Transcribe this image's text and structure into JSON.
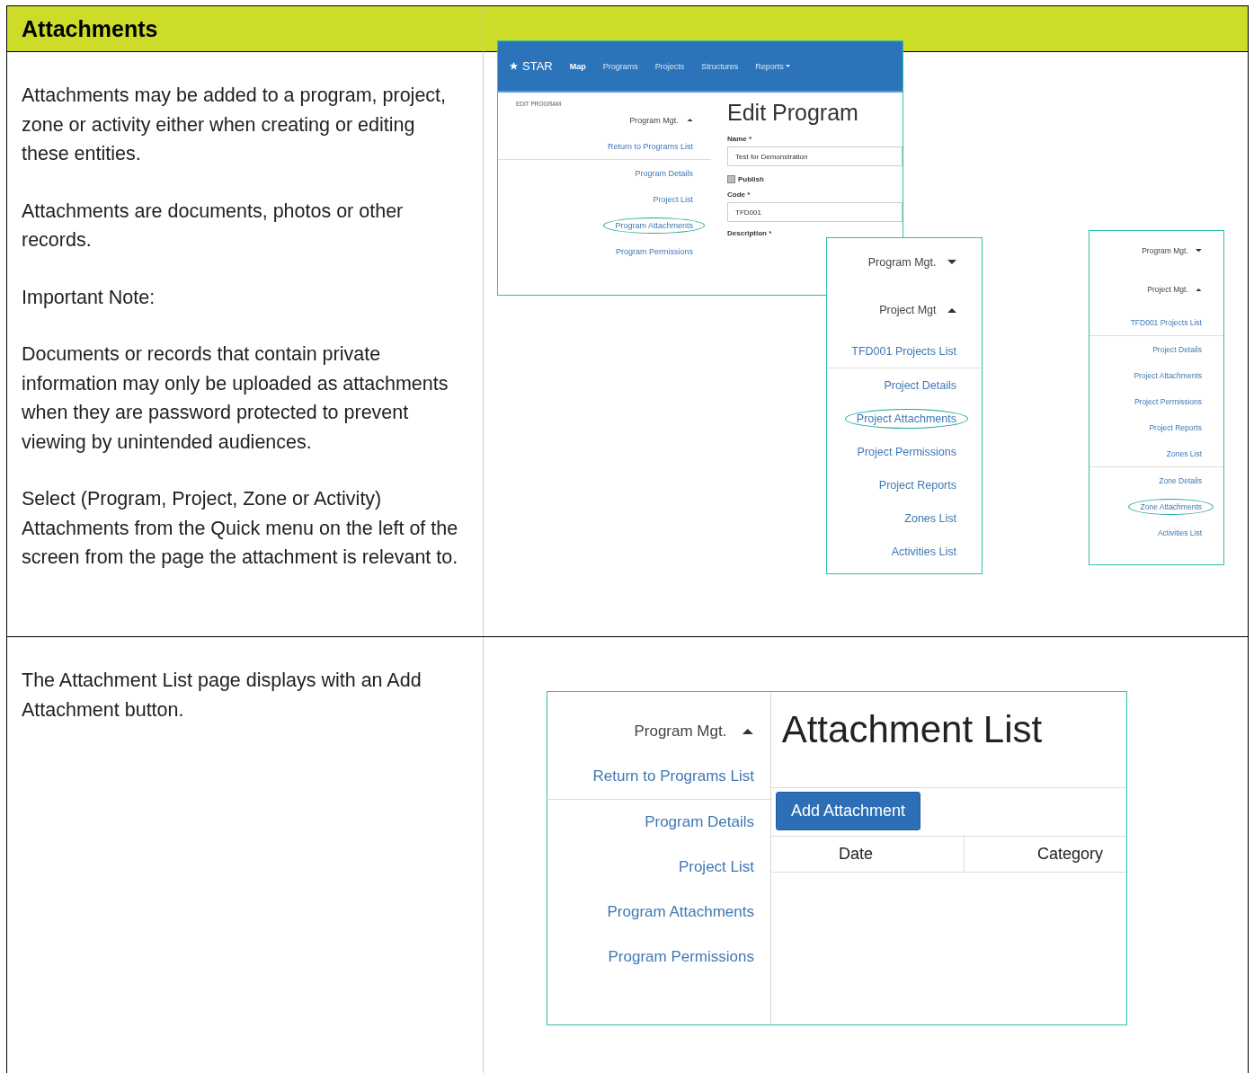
{
  "header": {
    "title": "Attachments"
  },
  "intro": {
    "paragraphs": [
      "Attachments may be added to a program, project, zone or activity either when creating or editing these entities.",
      "Attachments are documents, photos or other records.",
      "Important Note:",
      "Documents or records that contain private information may only be uploaded as attachments when they are password protected to prevent viewing by unintended audiences.",
      "Select (Program, Project, Zone or Activity) Attachments from the Quick menu on the left of the screen from the page the attachment is relevant to."
    ]
  },
  "edit_program_screenshot": {
    "navbar": {
      "brand": "STAR",
      "items": [
        {
          "label": "Map",
          "selected": true,
          "dropdown": false
        },
        {
          "label": "Programs",
          "selected": false,
          "dropdown": false
        },
        {
          "label": "Projects",
          "selected": false,
          "dropdown": false
        },
        {
          "label": "Structures",
          "selected": false,
          "dropdown": false
        },
        {
          "label": "Reports",
          "selected": false,
          "dropdown": true
        }
      ]
    },
    "breadcrumb": "EDIT PROGRAM",
    "sidebar": [
      {
        "kind": "group",
        "label": "Program Mgt.",
        "expanded": true
      },
      {
        "kind": "link",
        "label": "Return to Programs List",
        "circled": false
      },
      {
        "kind": "divider"
      },
      {
        "kind": "link",
        "label": "Program Details",
        "circled": false
      },
      {
        "kind": "link",
        "label": "Project List",
        "circled": false
      },
      {
        "kind": "link",
        "label": "Program Attachments",
        "circled": true
      },
      {
        "kind": "link",
        "label": "Program Permissions",
        "circled": false
      }
    ],
    "form": {
      "title": "Edit Program",
      "fields": [
        {
          "kind": "text",
          "label": "Name *",
          "value": "Test for Demonstration"
        },
        {
          "kind": "checkbox",
          "label": "Publish",
          "checked": true
        },
        {
          "kind": "text",
          "label": "Code *",
          "value": "TFD001"
        },
        {
          "kind": "label",
          "label": "Description *"
        }
      ]
    }
  },
  "project_menu_screenshot": {
    "sidebar": [
      {
        "kind": "group",
        "label": "Program Mgt.",
        "expanded": false
      },
      {
        "kind": "group",
        "label": "Project Mgt",
        "expanded": true
      },
      {
        "kind": "link",
        "label": "TFD001 Projects List",
        "circled": false
      },
      {
        "kind": "divider"
      },
      {
        "kind": "link",
        "label": "Project Details",
        "circled": false
      },
      {
        "kind": "link",
        "label": "Project Attachments",
        "circled": true
      },
      {
        "kind": "link",
        "label": "Project Permissions",
        "circled": false
      },
      {
        "kind": "link",
        "label": "Project Reports",
        "circled": false
      },
      {
        "kind": "link",
        "label": "Zones List",
        "circled": false
      },
      {
        "kind": "link",
        "label": "Activities List",
        "circled": false
      }
    ]
  },
  "zone_menu_screenshot": {
    "sidebar": [
      {
        "kind": "group",
        "label": "Program Mgt.",
        "expanded": false
      },
      {
        "kind": "group",
        "label": "Project Mgt.",
        "expanded": true
      },
      {
        "kind": "link",
        "label": "TFD001 Projects List",
        "circled": false
      },
      {
        "kind": "divider"
      },
      {
        "kind": "link",
        "label": "Project Details",
        "circled": false
      },
      {
        "kind": "link",
        "label": "Project Attachments",
        "circled": false
      },
      {
        "kind": "link",
        "label": "Project Permissions",
        "circled": false
      },
      {
        "kind": "link",
        "label": "Project Reports",
        "circled": false
      },
      {
        "kind": "link",
        "label": "Zones List",
        "circled": false
      },
      {
        "kind": "divider"
      },
      {
        "kind": "link",
        "label": "Zone Details",
        "circled": false
      },
      {
        "kind": "link",
        "label": "Zone Attachments",
        "circled": true
      },
      {
        "kind": "link",
        "label": "Activities List",
        "circled": false
      }
    ]
  },
  "list_intro": {
    "paragraphs": [
      "The Attachment List page displays with an Add Attachment button."
    ]
  },
  "attachment_list_screenshot": {
    "sidebar": [
      {
        "kind": "group",
        "label": "Program Mgt.",
        "expanded": true
      },
      {
        "kind": "link",
        "label": "Return to Programs List",
        "circled": false
      },
      {
        "kind": "divider"
      },
      {
        "kind": "link",
        "label": "Program Details",
        "circled": false
      },
      {
        "kind": "link",
        "label": "Project List",
        "circled": false
      },
      {
        "kind": "link",
        "label": "Program Attachments",
        "circled": false
      },
      {
        "kind": "link",
        "label": "Program Permissions",
        "circled": false
      }
    ],
    "title": "Attachment List",
    "button": "Add Attachment",
    "columns": [
      "Date",
      "Category"
    ]
  }
}
